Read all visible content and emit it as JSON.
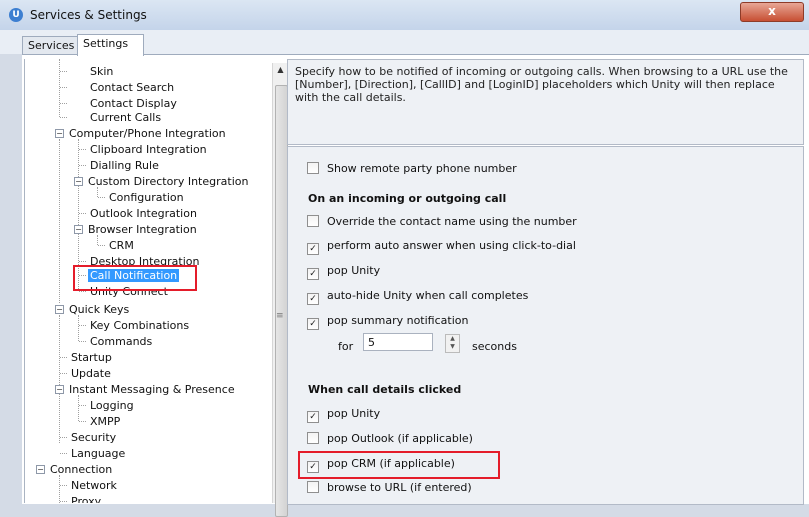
{
  "window": {
    "title": "Services & Settings",
    "app_icon": "U",
    "close_label": "x"
  },
  "tabs": [
    {
      "label": "Services"
    },
    {
      "label": "Settings"
    }
  ],
  "tree": {
    "items": [
      "Skin",
      "Contact Search",
      "Contact Display",
      "Current Calls",
      "Computer/Phone Integration",
      "Clipboard Integration",
      "Dialling Rule",
      "Custom Directory Integration",
      "Configuration",
      "Outlook Integration",
      "Browser Integration",
      "CRM",
      "Desktop Integration",
      "Call Notification",
      "Unity Connect",
      "Quick Keys",
      "Key Combinations",
      "Commands",
      "Startup",
      "Update",
      "Instant Messaging & Presence",
      "Logging",
      "XMPP",
      "Security",
      "Language",
      "Connection",
      "Network",
      "Proxy"
    ],
    "selected": "Call Notification"
  },
  "description": "Specify how to be notified of incoming or outgoing calls.  When browsing to a URL use the [Number], [Direction], [CallID] and [LoginID] placeholders which Unity will then replace with the call details.",
  "settings": {
    "show_remote": {
      "label": "Show remote party phone number",
      "checked": false
    },
    "section_call": "On an incoming or outgoing call",
    "override": {
      "label": "Override the contact name using the number",
      "checked": false
    },
    "auto_answer": {
      "label": "perform auto answer when using click-to-dial",
      "checked": true
    },
    "pop_unity": {
      "label": "pop Unity",
      "checked": true
    },
    "auto_hide": {
      "label": "auto-hide Unity when call completes",
      "checked": true
    },
    "pop_summary": {
      "label": "pop summary notification",
      "checked": true
    },
    "for_label": "for",
    "duration_value": "5",
    "seconds_label": "seconds",
    "section_clicked": "When call details clicked",
    "click_pop_unity": {
      "label": "pop Unity",
      "checked": true
    },
    "click_pop_outlook": {
      "label": "pop Outlook (if applicable)",
      "checked": false
    },
    "click_pop_crm": {
      "label": "pop CRM (if applicable)",
      "checked": true
    },
    "click_browse": {
      "label": "browse to URL (if entered)",
      "checked": false
    }
  },
  "colors": {
    "highlight": "#e41c2a",
    "selection": "#3399ff"
  }
}
